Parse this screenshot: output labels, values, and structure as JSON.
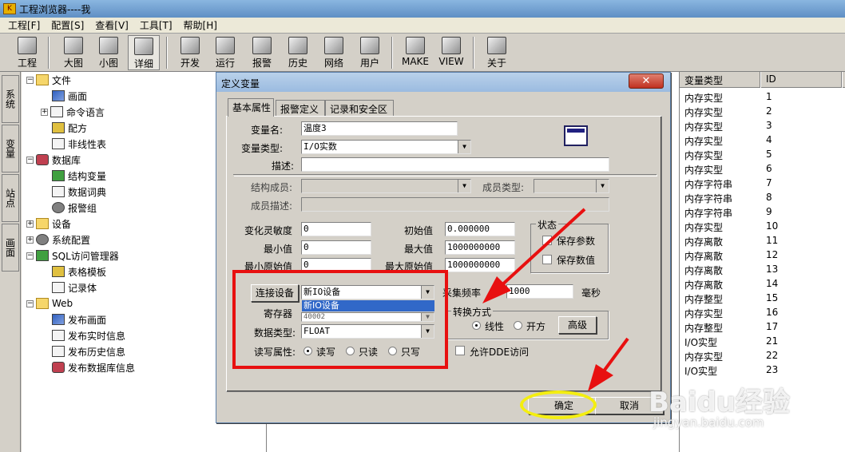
{
  "window": {
    "title": "工程浏览器----我"
  },
  "menu": [
    "工程[F]",
    "配置[S]",
    "查看[V]",
    "工具[T]",
    "帮助[H]"
  ],
  "toolbar": {
    "project": "工程",
    "large_icon": "大图",
    "small_icon": "小图",
    "detail": "详细",
    "develop": "开发",
    "run": "运行",
    "alarm": "报警",
    "history": "历史",
    "network": "网络",
    "user": "用户",
    "make": "MAKE",
    "view": "VIEW",
    "about": "关于"
  },
  "side_tabs": [
    "系统",
    "变量",
    "站点",
    "画面"
  ],
  "tree": {
    "file": "文件",
    "screen": "画面",
    "command_lang": "命令语言",
    "recipe": "配方",
    "nonlinear": "非线性表",
    "database": "数据库",
    "struct_var": "结构变量",
    "data_dict": "数据词典",
    "alarm_group": "报警组",
    "device": "设备",
    "sys_config": "系统配置",
    "sql": "SQL访问管理器",
    "table_template": "表格模板",
    "recordset": "记录体",
    "web": "Web",
    "pub_screen": "发布画面",
    "pub_realtime": "发布实时信息",
    "pub_history": "发布历史信息",
    "pub_db": "发布数据库信息"
  },
  "list": {
    "col_type": "变量类型",
    "col_id": "ID",
    "rows": [
      {
        "type": "内存实型",
        "id": "1"
      },
      {
        "type": "内存实型",
        "id": "2"
      },
      {
        "type": "内存实型",
        "id": "3"
      },
      {
        "type": "内存实型",
        "id": "4"
      },
      {
        "type": "内存实型",
        "id": "5"
      },
      {
        "type": "内存实型",
        "id": "6"
      },
      {
        "type": "内存字符串",
        "id": "7"
      },
      {
        "type": "内存字符串",
        "id": "8"
      },
      {
        "type": "内存字符串",
        "id": "9"
      },
      {
        "type": "内存实型",
        "id": "10"
      },
      {
        "type": "内存离散",
        "id": "11"
      },
      {
        "type": "内存离散",
        "id": "12"
      },
      {
        "type": "内存离散",
        "id": "13"
      },
      {
        "type": "内存离散",
        "id": "14"
      },
      {
        "type": "内存整型",
        "id": "15"
      },
      {
        "type": "内存实型",
        "id": "16"
      },
      {
        "type": "内存整型",
        "id": "17"
      },
      {
        "type": "I/O实型",
        "id": "21"
      },
      {
        "type": "内存实型",
        "id": "22"
      },
      {
        "type": "I/O实型",
        "id": "23"
      }
    ]
  },
  "dialog": {
    "title": "定义变量",
    "tabs": [
      "基本属性",
      "报警定义",
      "记录和安全区"
    ],
    "var_name_label": "变量名:",
    "var_name": "温度3",
    "var_type_label": "变量类型:",
    "var_type": "I/O实数",
    "desc_label": "描述:",
    "desc": "",
    "struct_member_label": "结构成员:",
    "member_type_label": "成员类型:",
    "member_desc_label": "成员描述:",
    "sensitivity_label": "变化灵敏度",
    "sensitivity": "0",
    "init_label": "初始值",
    "init": "0.000000",
    "min_label": "最小值",
    "min": "0",
    "max_label": "最大值",
    "max": "1000000000",
    "min_raw_label": "最小原始值",
    "min_raw": "0",
    "max_raw_label": "最大原始值",
    "max_raw": "1000000000",
    "state_group": "状态",
    "save_param": "保存参数",
    "save_value": "保存数值",
    "device_btn": "连接设备",
    "device_value": "新IO设备",
    "device_option": "新IO设备",
    "register_label": "寄存器",
    "register_value": "40002",
    "datatype_label": "数据类型:",
    "datatype_value": "FLOAT",
    "rw_label": "读写属性:",
    "rw_readwrite": "读写",
    "rw_read": "只读",
    "rw_write": "只写",
    "freq_label": "采集频率",
    "freq": "1000",
    "freq_unit": "毫秒",
    "convert_group": "转换方式",
    "linear": "线性",
    "sqrt": "开方",
    "advanced": "高级",
    "allow_dde": "允许DDE访问",
    "ok": "确定",
    "cancel": "取消"
  },
  "watermark": {
    "brand": "Baidu经验",
    "site": "jingyan.baidu.com"
  },
  "colors": {
    "annotation_red": "#e81010",
    "annotation_yellow": "#f4ee10",
    "selection": "#3168c8"
  }
}
